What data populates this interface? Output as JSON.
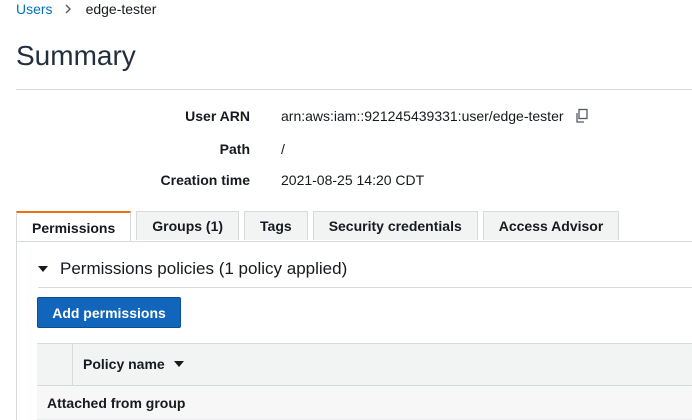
{
  "breadcrumb": {
    "parent": "Users",
    "separator_icon": "chevron-right-icon",
    "current": "edge-tester"
  },
  "page": {
    "title": "Summary"
  },
  "details": {
    "user_arn": {
      "label": "User ARN",
      "value": "arn:aws:iam::921245439331:user/edge-tester",
      "icon": "copy-icon"
    },
    "path": {
      "label": "Path",
      "value": "/"
    },
    "creation_time": {
      "label": "Creation time",
      "value": "2021-08-25 14:20 CDT"
    }
  },
  "tabs": [
    {
      "label": "Permissions",
      "active": true
    },
    {
      "label": "Groups (1)",
      "active": false
    },
    {
      "label": "Tags",
      "active": false
    },
    {
      "label": "Security credentials",
      "active": false
    },
    {
      "label": "Access Advisor",
      "active": false
    }
  ],
  "permissions": {
    "section_title": "Permissions policies (1 policy applied)",
    "add_button": "Add permissions",
    "table": {
      "columns": [
        "Policy name"
      ],
      "group_row": "Attached from group"
    }
  },
  "colors": {
    "link": "#0073bb",
    "primary_button": "#1166bb",
    "active_tab_accent": "#ec7211"
  }
}
